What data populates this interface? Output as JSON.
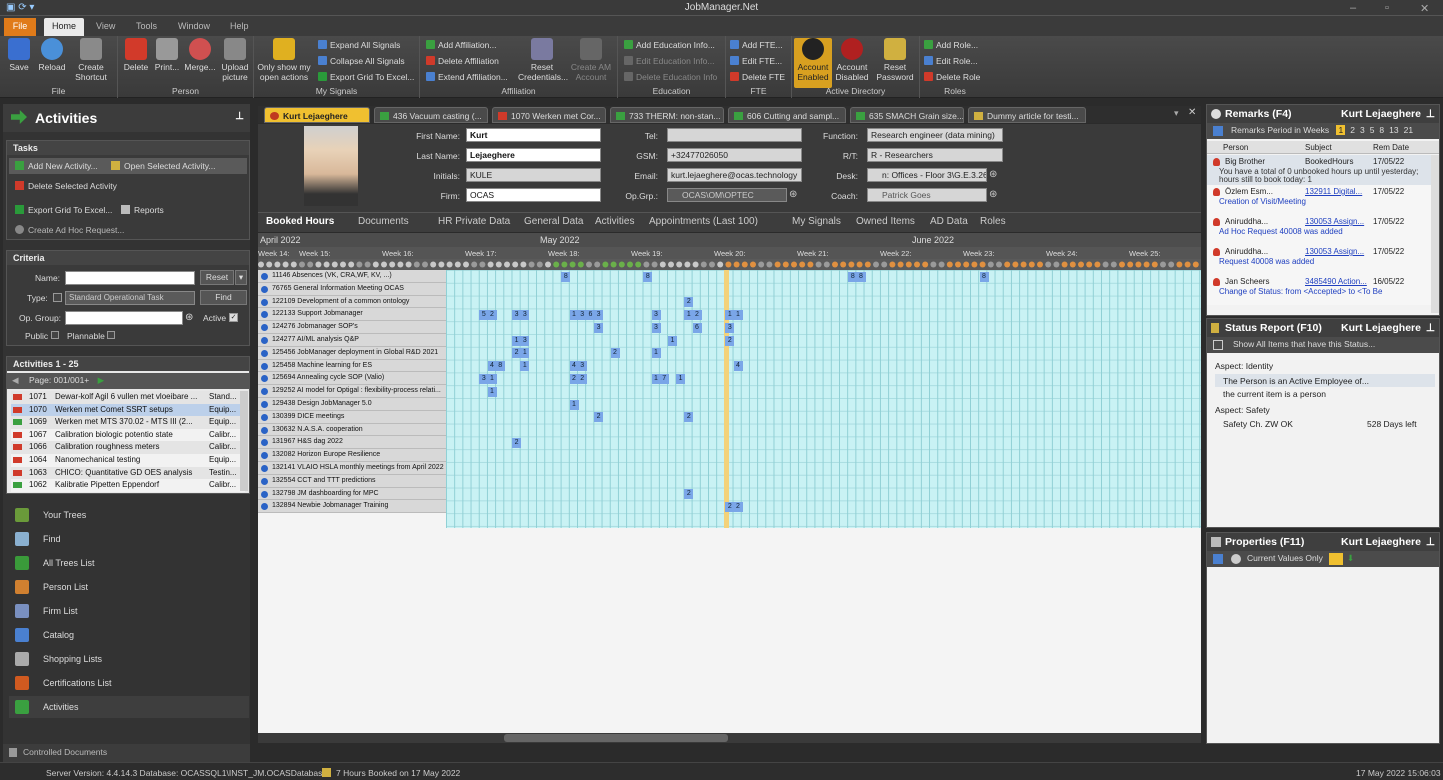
{
  "window": {
    "title": "JobManager.Net"
  },
  "ribbon_tabs": [
    "File",
    "Home",
    "View",
    "Tools",
    "Window",
    "Help"
  ],
  "ribbon": {
    "file_group": {
      "label": "File",
      "buttons": [
        "Save",
        "Reload",
        "Create Shortcut"
      ]
    },
    "person_group": {
      "label": "Person",
      "buttons": [
        "Delete",
        "Print...",
        "Merge...",
        "Upload picture"
      ]
    },
    "signals_group": {
      "label": "My Signals",
      "big": "Only show my open actions",
      "small": [
        "Expand All Signals",
        "Collapse All Signals",
        "Export Grid To Excel..."
      ]
    },
    "affiliation_group": {
      "label": "Affiliation",
      "small": [
        "Add Affiliation...",
        "Delete Affiliation",
        "Extend Affiliation..."
      ],
      "big": [
        "Reset Credentials...",
        "Create AM Account"
      ]
    },
    "education_group": {
      "label": "Education",
      "small": [
        "Add Education Info...",
        "Edit Education Info...",
        "Delete Education Info"
      ]
    },
    "fte_group": {
      "label": "FTE",
      "small": [
        "Add FTE...",
        "Edit FTE...",
        "Delete FTE"
      ]
    },
    "ad_group": {
      "label": "Active Directory",
      "big": [
        "Account Enabled",
        "Account Disabled",
        "Reset Password"
      ]
    },
    "roles_group": {
      "label": "Roles",
      "small": [
        "Add Role...",
        "Edit Role...",
        "Delete Role"
      ]
    }
  },
  "left": {
    "title": "Activities",
    "tasks_label": "Tasks",
    "tasks": {
      "add": "Add New Activity...",
      "open": "Open Selected Activity...",
      "delete": "Delete Selected Activity",
      "export": "Export Grid To Excel...",
      "reports": "Reports",
      "adhoc": "Create Ad Hoc Request..."
    },
    "criteria_label": "Criteria",
    "criteria": {
      "name_label": "Name:",
      "reset": "Reset",
      "type_label": "Type:",
      "type_value": "Standard Operational Task",
      "find": "Find",
      "opgroup_label": "Op. Group:",
      "active_label": "Active",
      "public_label": "Public",
      "plannable_label": "Plannable"
    },
    "list_label": "Activities 1 - 25",
    "page_label": "Page: 001/001+",
    "activities": [
      {
        "id": "1071",
        "name": "Dewar-kolf Agil 6 vullen met vloeibare ...",
        "type": "Stand..."
      },
      {
        "id": "1070",
        "name": "Werken met Comet SSRT setups",
        "type": "Equip..."
      },
      {
        "id": "1069",
        "name": "Werken met MTS 370.02 - MTS III (2...",
        "type": "Equip..."
      },
      {
        "id": "1067",
        "name": "Calibration biologic potentio state",
        "type": "Calibr..."
      },
      {
        "id": "1066",
        "name": "Calibration roughness meters",
        "type": "Calibr..."
      },
      {
        "id": "1064",
        "name": "Nanomechanical testing",
        "type": "Equip..."
      },
      {
        "id": "1063",
        "name": "CHICO: Quantitative GD OES analysis",
        "type": "Testin..."
      },
      {
        "id": "1062",
        "name": "Kalibratie Pipetten Eppendorf",
        "type": "Calibr..."
      }
    ],
    "nav": [
      "Your Trees",
      "Find",
      "All Trees List",
      "Person List",
      "Firm List",
      "Catalog",
      "Shopping Lists",
      "Certifications List",
      "Activities"
    ],
    "controlled": "Controlled Documents"
  },
  "doc_tabs": [
    "Kurt Lejaeghere",
    "436 Vacuum casting (...",
    "1070 Werken met Cor...",
    "733 THERM: non-stan...",
    "606 Cutting and sampl...",
    "635 SMACH Grain size...",
    "Dummy article for testi..."
  ],
  "person": {
    "first_name_label": "First Name:",
    "first_name": "Kurt",
    "last_name_label": "Last Name:",
    "last_name": "Lejaeghere",
    "initials_label": "Initials:",
    "initials": "KULE",
    "firm_label": "Firm:",
    "firm": "OCAS",
    "tel_label": "Tel:",
    "tel": "",
    "gsm_label": "GSM:",
    "gsm": "+32477026050",
    "email_label": "Email:",
    "email": "kurt.lejaeghere@ocas.technology",
    "opgrp_label": "Op.Grp.:",
    "opgrp": "OCAS\\OM\\OPTEC",
    "function_label": "Function:",
    "function": "Research engineer (data mining)",
    "rt_label": "R/T:",
    "rt": "R - Researchers",
    "desk_label": "Desk:",
    "desk": "n: Offices - Floor 3\\G.E.3.26",
    "coach_label": "Coach:",
    "coach": "Patrick Goes"
  },
  "sub_tabs": [
    "Booked Hours",
    "Documents",
    "HR Private Data",
    "General Data",
    "Activities",
    "Appointments (Last 100)",
    "My Signals",
    "Owned Items",
    "AD Data",
    "Roles"
  ],
  "grid": {
    "months": [
      "April 2022",
      "May 2022",
      "June 2022"
    ],
    "weeks": [
      "Week 14:",
      "Week 15:",
      "Week 16:",
      "Week 17:",
      "Week 18:",
      "Week 19:",
      "Week 20:",
      "Week 21:",
      "Week 22:",
      "Week 23:",
      "Week 24:",
      "Week 25:"
    ],
    "rows": [
      "11146 Absences (VK, CRA,WF, KV, ...)",
      "76765 General Information Meeting OCAS",
      "122109 Development of a common ontology",
      "122133 Support Jobmanager",
      "124276 Jobmanager SOP's",
      "124277 AI/ML analysis Q&P",
      "125456 JobManager deployment in Global R&D 2021",
      "125458 Machine learning for ES",
      "125694 Annealing cycle SOP (Valio)",
      "129252 AI model for Optigal : flexibility-process relati...",
      "129438 Design JobManager 5.0",
      "130399 DICE meetings",
      "130632 N.A.S.A. cooperation",
      "131967 H&S dag 2022",
      "132082 Horizon Europe Resilience",
      "132141 VLAIO HSLA monthly meetings from April 2022",
      "132554 CCT and TTT predictions",
      "132798 JM dashboarding for MPC",
      "132894 Newbie Jobmanager Training"
    ],
    "bookings": [
      [
        0,
        36,
        "8"
      ],
      [
        0,
        46,
        "8"
      ],
      [
        0,
        71,
        "8"
      ],
      [
        0,
        72,
        "8"
      ],
      [
        0,
        87,
        "8"
      ],
      [
        2,
        51,
        "2"
      ],
      [
        3,
        26,
        "5"
      ],
      [
        3,
        27,
        "2"
      ],
      [
        3,
        30,
        "3"
      ],
      [
        3,
        31,
        "3"
      ],
      [
        3,
        37,
        "1"
      ],
      [
        3,
        38,
        "3"
      ],
      [
        3,
        39,
        "6"
      ],
      [
        3,
        40,
        "3"
      ],
      [
        3,
        47,
        "3"
      ],
      [
        3,
        51,
        "1"
      ],
      [
        3,
        52,
        "2"
      ],
      [
        3,
        56,
        "1"
      ],
      [
        3,
        57,
        "1"
      ],
      [
        4,
        40,
        "3"
      ],
      [
        4,
        47,
        "3"
      ],
      [
        4,
        52,
        "6"
      ],
      [
        4,
        56,
        "3"
      ],
      [
        5,
        30,
        "1"
      ],
      [
        5,
        31,
        "3"
      ],
      [
        5,
        49,
        "1"
      ],
      [
        5,
        56,
        "2"
      ],
      [
        6,
        30,
        "2"
      ],
      [
        6,
        31,
        "1"
      ],
      [
        6,
        42,
        "2"
      ],
      [
        6,
        47,
        "1"
      ],
      [
        7,
        27,
        "4"
      ],
      [
        7,
        28,
        "8"
      ],
      [
        7,
        31,
        "1"
      ],
      [
        7,
        37,
        "4"
      ],
      [
        7,
        38,
        "3"
      ],
      [
        7,
        57,
        "4"
      ],
      [
        8,
        26,
        "3"
      ],
      [
        8,
        27,
        "1"
      ],
      [
        8,
        37,
        "2"
      ],
      [
        8,
        38,
        "2"
      ],
      [
        8,
        47,
        "1"
      ],
      [
        8,
        48,
        "7"
      ],
      [
        8,
        50,
        "1"
      ],
      [
        9,
        27,
        "1"
      ],
      [
        10,
        37,
        "1"
      ],
      [
        11,
        40,
        "2"
      ],
      [
        11,
        51,
        "2"
      ],
      [
        13,
        30,
        "2"
      ],
      [
        17,
        51,
        "2"
      ],
      [
        18,
        56,
        "2"
      ],
      [
        18,
        57,
        "2"
      ]
    ]
  },
  "remarks": {
    "title": "Remarks (F4)",
    "person": "Kurt Lejaeghere",
    "period_label": "Remarks Period in Weeks",
    "periods": [
      "1",
      "2",
      "3",
      "5",
      "8",
      "13",
      "21"
    ],
    "columns": [
      "Person",
      "Subject",
      "Rem Date"
    ],
    "items": [
      {
        "person": "Big Brother",
        "subject": "BookedHours",
        "date": "17/05/22",
        "text": "You have a total of 0 unbooked hours up until yesterday; hours still to book today: 1"
      },
      {
        "person": "Özlem Esm...",
        "subject": "132911 Digital...",
        "date": "17/05/22",
        "text": "Creation of Visit/Meeting"
      },
      {
        "person": "Aniruddha...",
        "subject": "130053 Assign...",
        "date": "17/05/22",
        "text": "Ad Hoc Request 40008 was added"
      },
      {
        "person": "Aniruddha...",
        "subject": "130053 Assign...",
        "date": "17/05/22",
        "text": "Request 40008 was added"
      },
      {
        "person": "Jan Scheers",
        "subject": "3485490 Action...",
        "date": "16/05/22",
        "text": "Change of Status: from <Accepted> to <To Be"
      }
    ]
  },
  "status": {
    "title": "Status Report (F10)",
    "person": "Kurt Lejaeghere",
    "toolbar": "Show All Items that have this Status...",
    "aspect1": "Aspect: Identity",
    "line1": "The Person is an Active Employee of...",
    "line2": "the current item is a person",
    "aspect2": "Aspect: Safety",
    "safety_name": "Safety Ch. ZW OK",
    "safety_value": "528 Days left"
  },
  "properties": {
    "title": "Properties (F11)",
    "person": "Kurt Lejaeghere",
    "toolbar": "Current Values Only"
  },
  "statusbar": {
    "server": "Server Version: 4.4.14.3 Database: OCASSQL1\\INST_JM.OCASDatabase",
    "booked": "7 Hours Booked on 17 May 2022",
    "datetime": "17 May 2022 15:06:03"
  },
  "colors": {
    "accent": "#f0c030",
    "file_tab": "#e07b1a",
    "grid_cell": "#c9f2f4",
    "booking": "#7aa6e8"
  }
}
